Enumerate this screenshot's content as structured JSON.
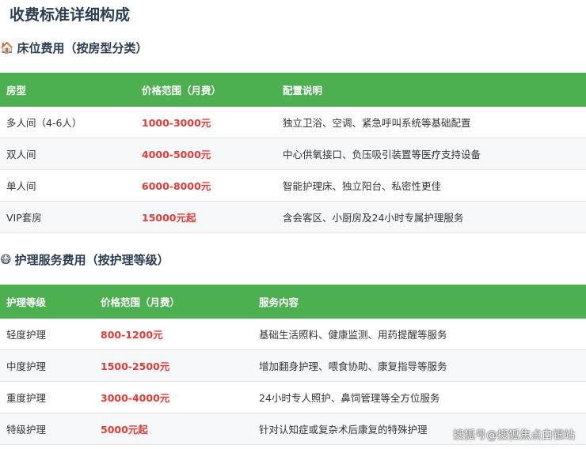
{
  "title": "收费标准详细构成",
  "bed": {
    "heading": "床位费用（按房型分类）",
    "icon": "house-icon",
    "headers": [
      "房型",
      "价格范围（月费）",
      "配置说明"
    ],
    "rows": [
      [
        "多人间（4-6人）",
        "1000-3000元",
        "独立卫浴、空调、紧急呼叫系统等基础配置"
      ],
      [
        "双人间",
        "4000-5000元",
        "中心供氧接口、负压吸引装置等医疗支持设备"
      ],
      [
        "单人间",
        "6000-8000元",
        "智能护理床、独立阳台、私密性更佳"
      ],
      [
        "VIP套房",
        "15000元起",
        "含会客区、小厨房及24小时专属护理服务"
      ]
    ]
  },
  "care": {
    "heading": "护理服务费用（按护理等级）",
    "icon": "face-mask-icon",
    "headers": [
      "护理等级",
      "价格范围（月费）",
      "服务内容"
    ],
    "rows": [
      [
        "轻度护理",
        "800-1200元",
        "基础生活照料、健康监测、用药提醒等服务"
      ],
      [
        "中度护理",
        "1500-2500元",
        "增加翻身护理、喂食协助、康复指导等服务"
      ],
      [
        "重度护理",
        "3000-4000元",
        "24小时专人照护、鼻饲管理等全方位服务"
      ],
      [
        "特级护理",
        "5000元起",
        "针对认知症或复杂术后康复的特殊护理"
      ]
    ]
  },
  "watermark": "搜狐号@搜狐焦点白银站",
  "colors": {
    "header": "#4caf50",
    "price": "#e53935"
  }
}
